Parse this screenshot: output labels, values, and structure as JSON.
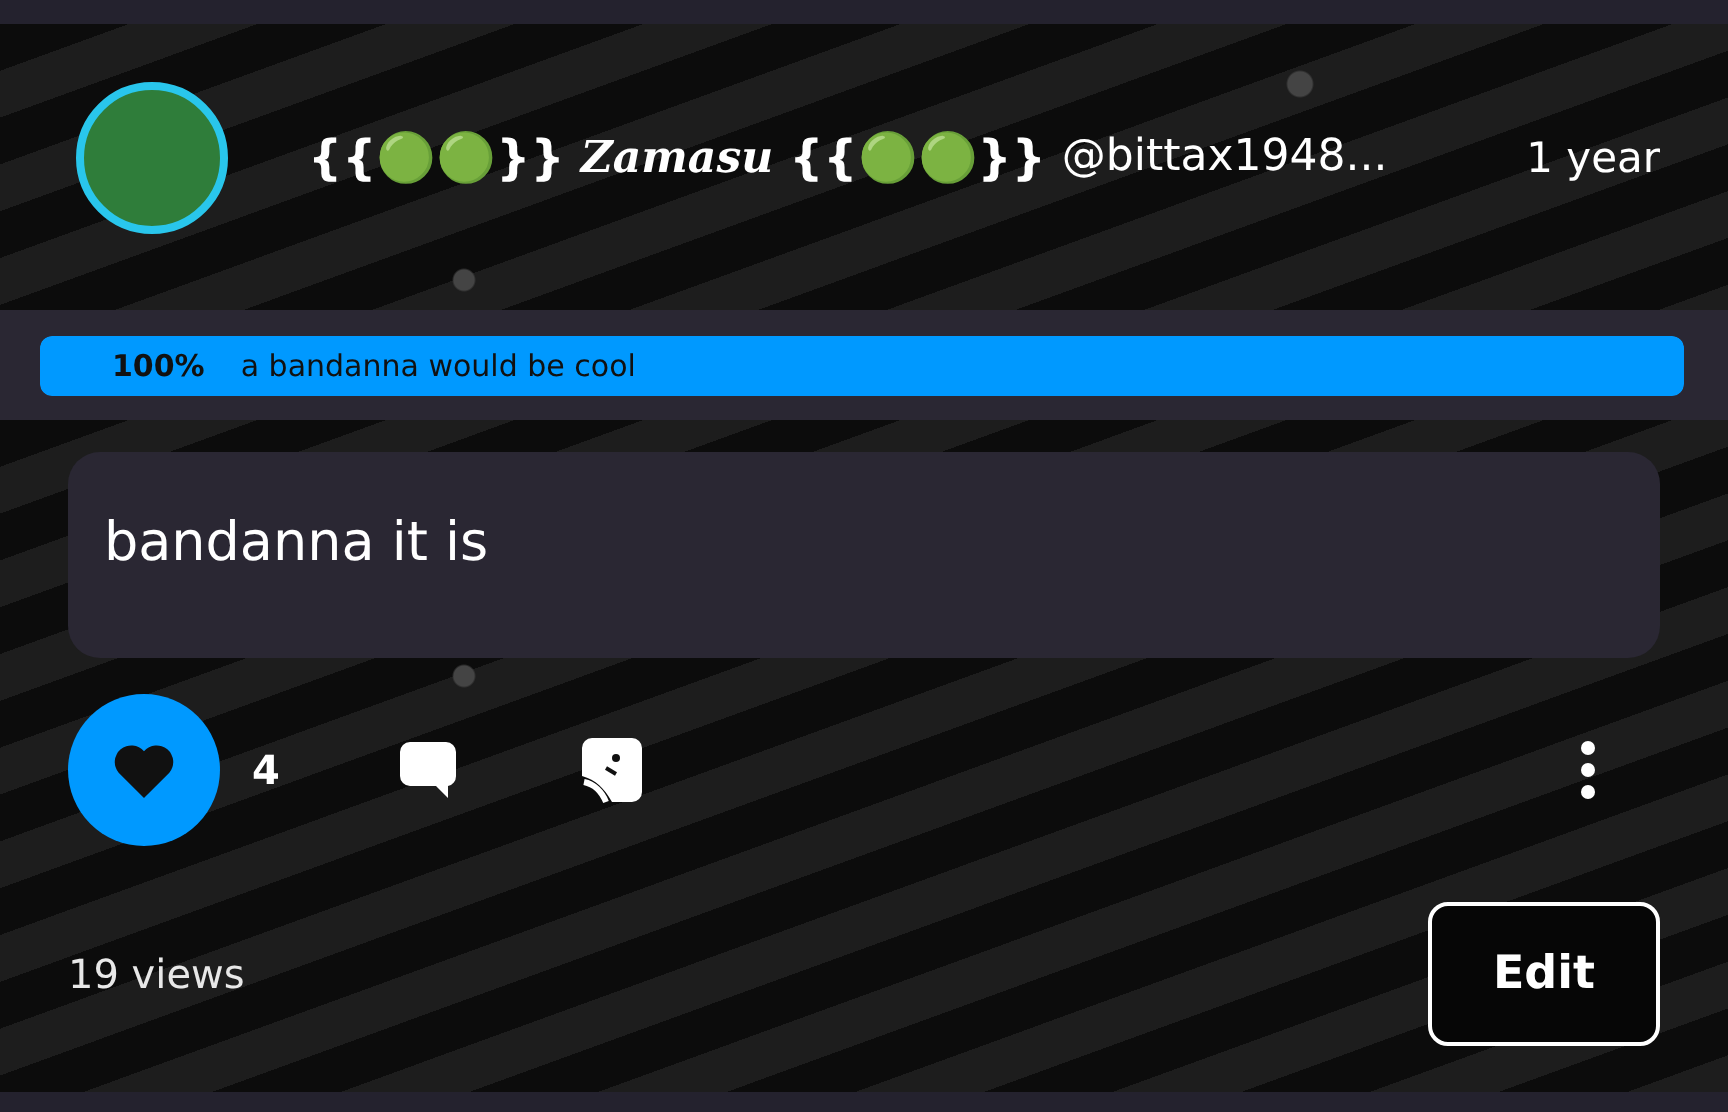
{
  "post": {
    "author": {
      "name_start": "{{🟢🟢}}",
      "name_styled": "Zamasu",
      "name_end": "{{🟢🟢}}",
      "handle": "@bittax1948...",
      "time": "1 year"
    },
    "poll": {
      "percent": "100%",
      "option": "a bandanna would be cool",
      "level": 1
    },
    "text": "bandanna it is",
    "actions": {
      "liked": true,
      "like_count": "4"
    },
    "views": "19 views",
    "edit_button": "Edit"
  }
}
